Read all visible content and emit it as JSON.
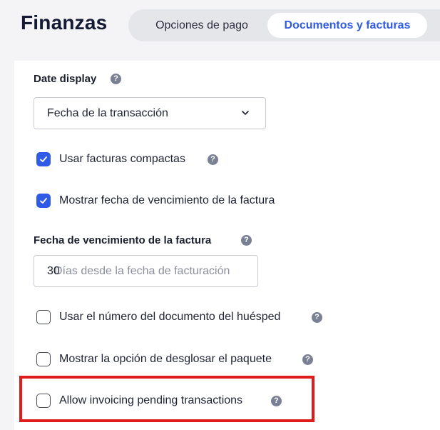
{
  "header": {
    "title": "Finanzas",
    "tabs": [
      {
        "label": "Opciones de pago",
        "active": false
      },
      {
        "label": "Documentos y facturas",
        "active": true
      }
    ]
  },
  "settings": {
    "date_display": {
      "label": "Date display",
      "selected": "Fecha de la transacción"
    },
    "compact_invoices": {
      "label": "Usar facturas compactas",
      "checked": true
    },
    "show_due_date": {
      "label": "Mostrar fecha de vencimiento de la factura",
      "checked": true
    },
    "due_date": {
      "label": "Fecha de vencimiento de la factura",
      "value": "30",
      "placeholder": "Días desde la fecha de facturación"
    },
    "guest_document_number": {
      "label": "Usar el número del documento del huésped",
      "checked": false
    },
    "package_breakdown": {
      "label": "Mostrar la opción de desglosar el paquete",
      "checked": false
    },
    "pending_transactions": {
      "label": "Allow invoicing pending transactions",
      "checked": false
    }
  },
  "icons": {
    "help": "question-circle-icon",
    "chevron": "chevron-down-icon",
    "check": "checkmark-icon"
  },
  "colors": {
    "accent": "#2f5be7",
    "highlight": "#e01b1b",
    "background": "#f4f4f6"
  }
}
